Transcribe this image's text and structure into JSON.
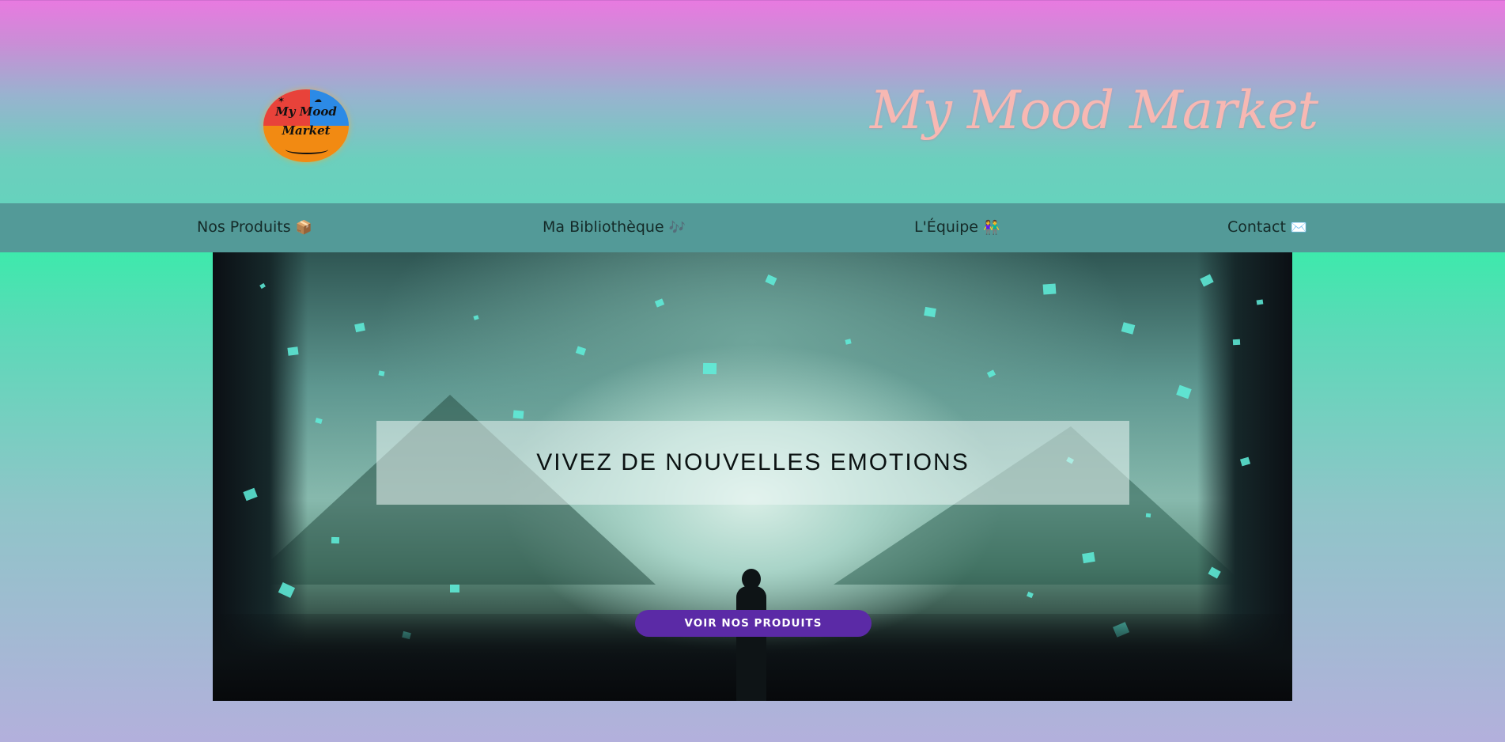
{
  "header": {
    "logo_text_line1": "My Mood",
    "logo_text_line2": "Market",
    "brand_title": "My Mood Market"
  },
  "nav": {
    "items": [
      {
        "label": "Nos Produits",
        "icon": "📦",
        "icon_name": "package-icon"
      },
      {
        "label": "Ma Bibliothèque",
        "icon": "🎶",
        "icon_name": "music-notes-icon"
      },
      {
        "label": "L'Équipe",
        "icon": "👫",
        "icon_name": "people-icon"
      },
      {
        "label": "Contact",
        "icon": "✉️",
        "icon_name": "envelope-icon"
      }
    ]
  },
  "hero": {
    "headline": "VIVEZ DE NOUVELLES EMOTIONS",
    "cta_label": "VOIR NOS PRODUITS"
  },
  "colors": {
    "header_top": "#e87ae0",
    "header_bottom": "#66d2bd",
    "nav_bg": "#539a98",
    "brand_text": "#f7b8b3",
    "cta_bg": "#5b2aa6",
    "page_bg_top": "#3ee9ac",
    "page_bg_bottom": "#b3b0dc"
  }
}
